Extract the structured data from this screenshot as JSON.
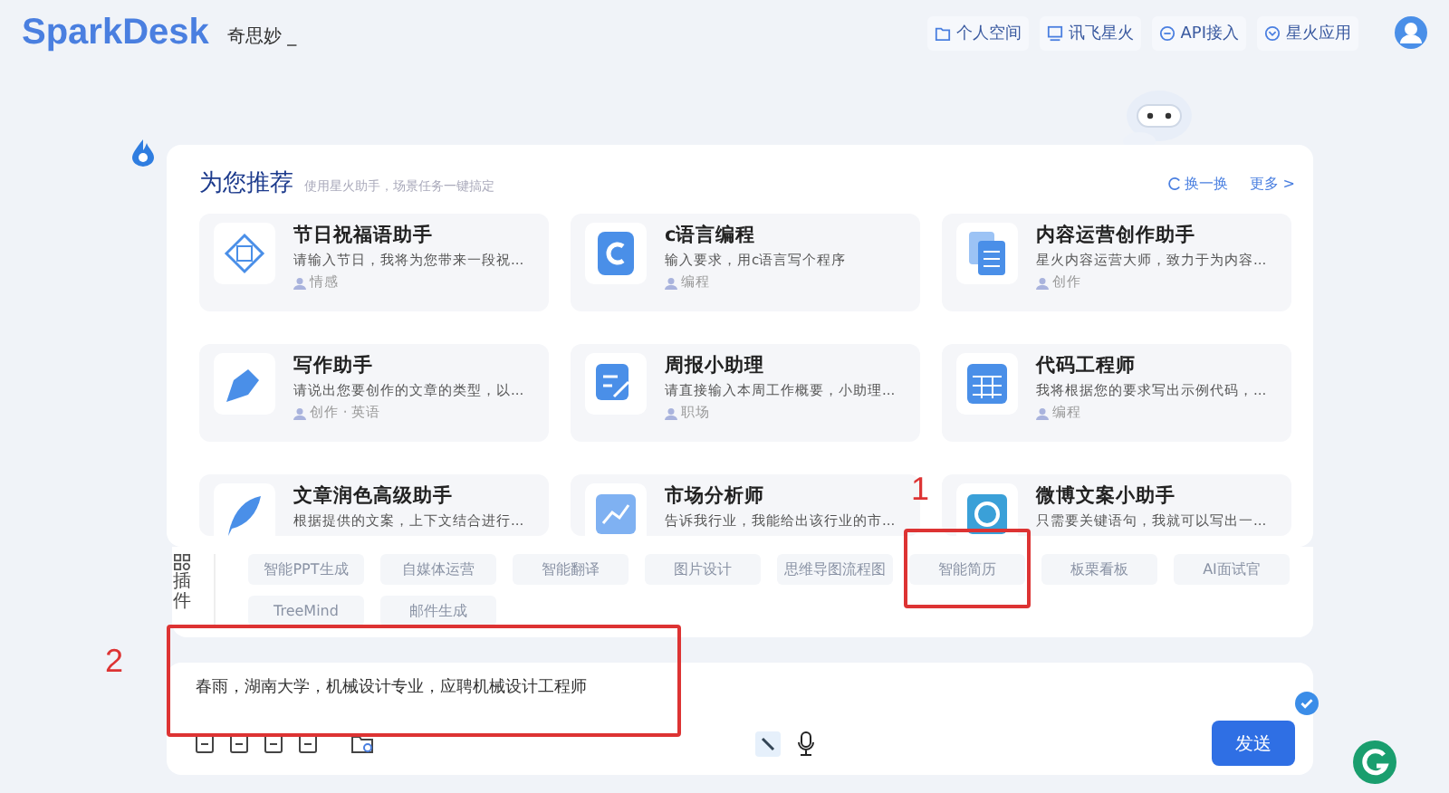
{
  "header": {
    "logo": "SparkDesk",
    "subtitle": "奇思妙 _",
    "links": [
      {
        "kind": "folder",
        "label": "个人空间"
      },
      {
        "kind": "screen",
        "label": "讯飞星火"
      },
      {
        "kind": "api",
        "label": "API接入"
      },
      {
        "kind": "app",
        "label": "星火应用"
      }
    ]
  },
  "recommend": {
    "title": "为您推荐",
    "subtitle": "使用星火助手，场景任务一键搞定",
    "refresh": "换一换",
    "more": "更多 >",
    "cards": [
      {
        "kind": "fu",
        "title": "节日祝福语助手",
        "desc": "请输入节日，我将为您带来一段祝...",
        "tag": "情感"
      },
      {
        "kind": "c",
        "title": "c语言编程",
        "desc": "输入要求，用c语言写个程序",
        "tag": "编程"
      },
      {
        "kind": "docs",
        "title": "内容运营创作助手",
        "desc": "星火内容运营大师，致力于为内容...",
        "tag": "创作"
      },
      {
        "kind": "pen",
        "title": "写作助手",
        "desc": "请说出您要创作的文章的类型，以...",
        "tag": "创作 · 英语"
      },
      {
        "kind": "note",
        "title": "周报小助理",
        "desc": "请直接输入本周工作概要，小助理...",
        "tag": "职场"
      },
      {
        "kind": "calc",
        "title": "代码工程师",
        "desc": "我将根据您的要求写出示例代码，...",
        "tag": "编程"
      },
      {
        "kind": "feather",
        "title": "文章润色高级助手",
        "desc": "根据提供的文案，上下文结合进行..."
      },
      {
        "kind": "chart",
        "title": "市场分析师",
        "desc": "告诉我行业，我能给出该行业的市..."
      },
      {
        "kind": "weibo",
        "title": "微博文案小助手",
        "desc": "只需要关键语句，我就可以写出一..."
      }
    ]
  },
  "plugins": {
    "label": "插件",
    "items": [
      "智能PPT生成",
      "自媒体运营",
      "智能翻译",
      "图片设计",
      "思维导图流程图",
      "智能简历",
      "板栗看板",
      "AI面试官",
      "TreeMind",
      "邮件生成"
    ]
  },
  "input": {
    "value": "春雨，湖南大学，机械设计专业，应聘机械设计工程师",
    "send": "发送"
  },
  "annotations": [
    {
      "label": "1"
    },
    {
      "label": "2"
    }
  ]
}
